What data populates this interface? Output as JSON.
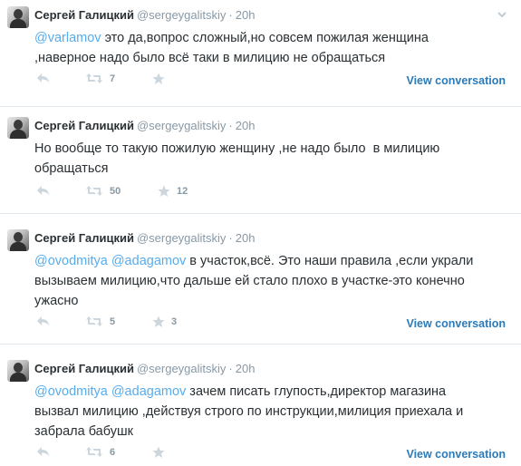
{
  "colors": {
    "link": "#55acee",
    "meta": "#8899a6",
    "view_link": "#2b7bb9"
  },
  "tweets": [
    {
      "name": "Сергей Галицкий",
      "handle": "@sergeygalitskiy",
      "dot": "·",
      "time": "20h",
      "mention1": "@varlamov",
      "mention2": "",
      "text": " это да,вопрос сложный,но совсем пожилая женщина\n,наверное надо было всё таки в милицию не обращаться",
      "retweets": "7",
      "favorites": "",
      "view": "View conversation"
    },
    {
      "name": "Сергей Галицкий",
      "handle": "@sergeygalitskiy",
      "dot": "·",
      "time": "20h",
      "mention1": "",
      "mention2": "",
      "text": "Но вообще то такую пожилую женщину ,не надо было  в милицию\nобращаться",
      "retweets": "50",
      "favorites": "12",
      "view": ""
    },
    {
      "name": "Сергей Галицкий",
      "handle": "@sergeygalitskiy",
      "dot": "·",
      "time": "20h",
      "mention1": "@ovodmitya",
      "mention2": " @adagamov",
      "text": " в участок,всё. Это наши правила ,если украли\nвызываем милицию,что дальше ей стало плохо в участке-это конечно\nужасно",
      "retweets": "5",
      "favorites": "3",
      "view": "View conversation"
    },
    {
      "name": "Сергей Галицкий",
      "handle": "@sergeygalitskiy",
      "dot": "·",
      "time": "20h",
      "mention1": "@ovodmitya",
      "mention2": " @adagamov",
      "text": " зачем писать глупость,директор магазина\nвызвал милицию ,действуя строго по инструкции,милиция приехала и\nзабрала бабушк",
      "retweets": "6",
      "favorites": "",
      "view": "View conversation"
    }
  ]
}
